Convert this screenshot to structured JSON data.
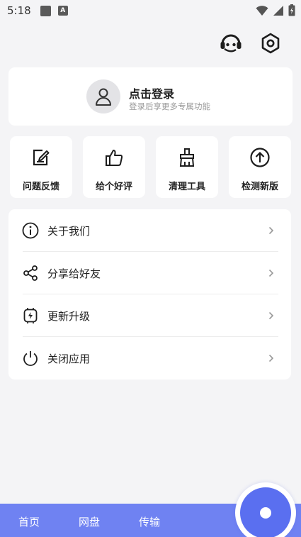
{
  "status_bar": {
    "time": "5:18",
    "notif_a": "A"
  },
  "header": {
    "support_icon": "headset-icon",
    "settings_icon": "settings-hexagon-icon"
  },
  "login": {
    "title": "点击登录",
    "subtitle": "登录后享更多专属功能",
    "avatar_icon": "user-icon"
  },
  "tools": [
    {
      "label": "问题反馈",
      "icon": "feedback-edit-icon"
    },
    {
      "label": "给个好评",
      "icon": "thumbs-up-icon"
    },
    {
      "label": "清理工具",
      "icon": "brush-icon"
    },
    {
      "label": "检测新版",
      "icon": "upload-circle-icon"
    }
  ],
  "menu": [
    {
      "label": "关于我们",
      "icon": "info-icon"
    },
    {
      "label": "分享给好友",
      "icon": "share-icon"
    },
    {
      "label": "更新升级",
      "icon": "update-chip-icon"
    },
    {
      "label": "关闭应用",
      "icon": "power-icon"
    }
  ],
  "bottom_nav": {
    "tabs": [
      "首页",
      "网盘",
      "传输"
    ]
  },
  "colors": {
    "accent": "#6f82f2",
    "fab": "#5a6ff0",
    "background": "#f4f4f6",
    "card": "#ffffff"
  }
}
